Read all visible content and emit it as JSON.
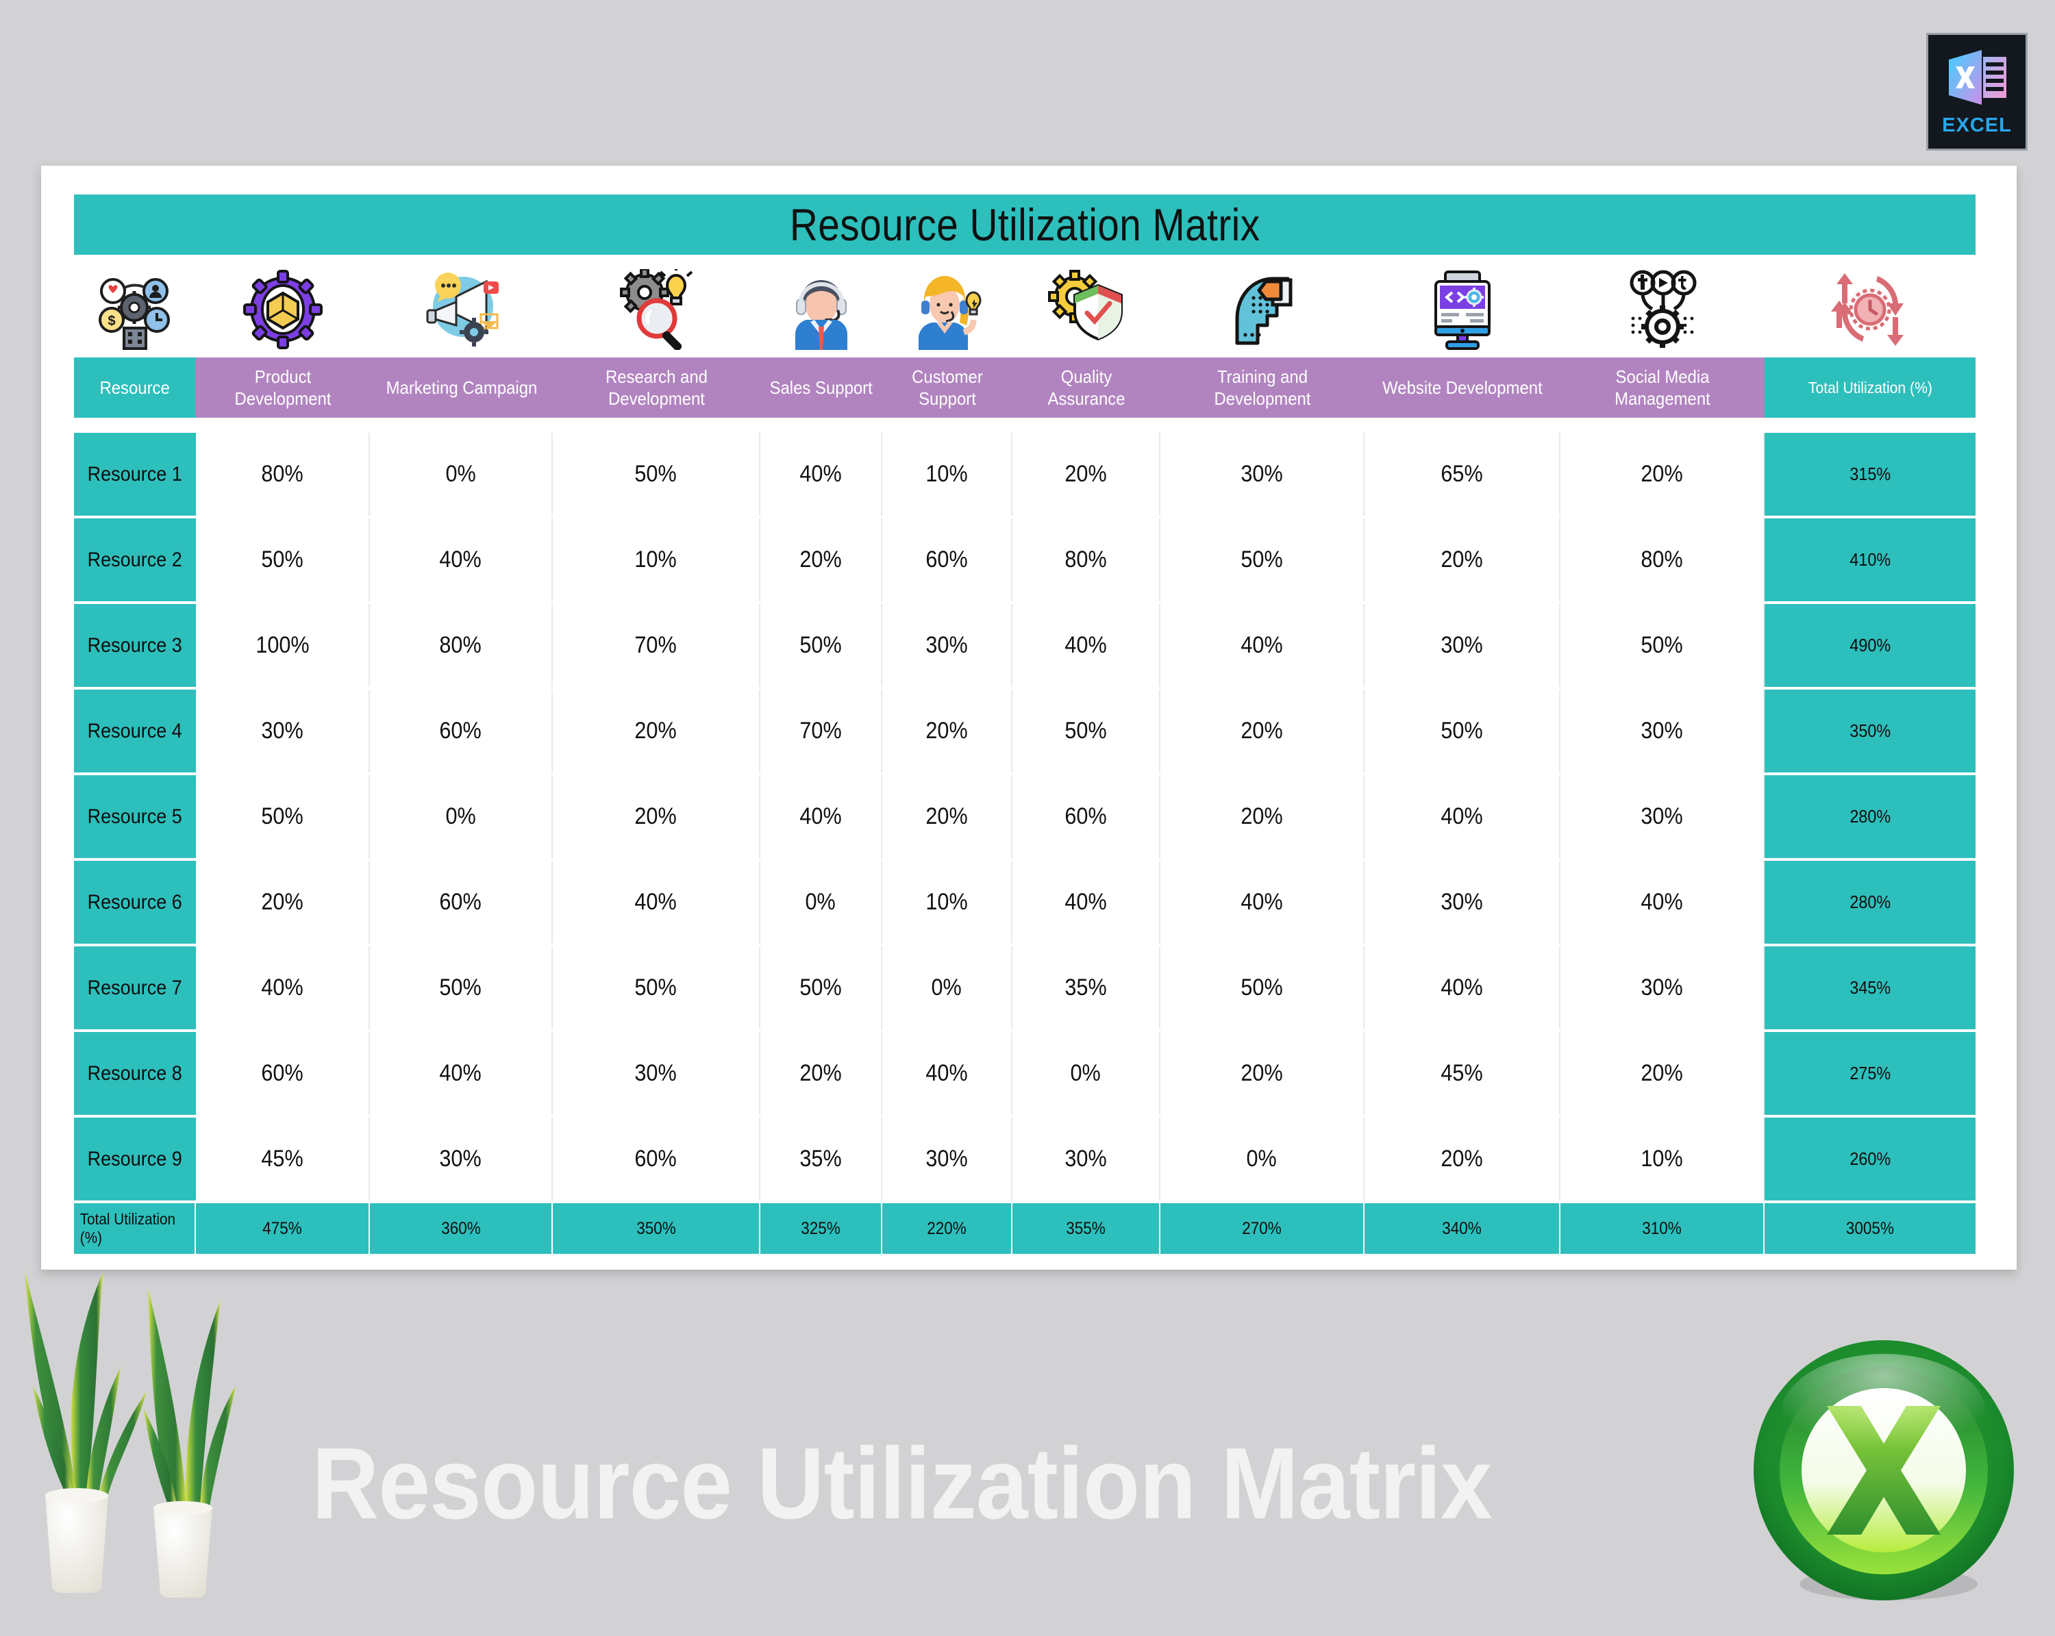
{
  "app_badge": {
    "label": "EXCEL",
    "icon": "excel-file-icon"
  },
  "sheet": {
    "title": "Resource Utilization Matrix",
    "header_icons": [
      "resource-management-icon",
      "product-development-gear-box-icon",
      "marketing-megaphone-icon",
      "research-gear-magnifier-bulb-icon",
      "sales-support-agent-icon",
      "customer-support-agent-icon",
      "quality-assurance-shield-gear-icon",
      "training-development-head-icon",
      "website-development-monitor-icon",
      "social-media-management-icon",
      "total-utilization-clock-arrows-icon"
    ],
    "columns": [
      "Resource",
      "Product Development",
      "Marketing Campaign",
      "Research and Development",
      "Sales Support",
      "Customer Support",
      "Quality Assurance",
      "Training and Development",
      "Website Development",
      "Social Media Management",
      "Total Utilization (%)"
    ],
    "total_row_label": "Total Utilization (%)"
  },
  "chart_data": {
    "type": "table",
    "title": "Resource Utilization Matrix",
    "categories": [
      "Product Development",
      "Marketing Campaign",
      "Research and Development",
      "Sales Support",
      "Customer Support",
      "Quality Assurance",
      "Training and Development",
      "Website Development",
      "Social Media Management"
    ],
    "row_labels": [
      "Resource 1",
      "Resource 2",
      "Resource 3",
      "Resource 4",
      "Resource 5",
      "Resource 6",
      "Resource 7",
      "Resource 8",
      "Resource 9"
    ],
    "rows": [
      {
        "label": "Resource 1",
        "values": [
          "80%",
          "0%",
          "50%",
          "40%",
          "10%",
          "20%",
          "30%",
          "65%",
          "20%"
        ],
        "total": "315%"
      },
      {
        "label": "Resource 2",
        "values": [
          "50%",
          "40%",
          "10%",
          "20%",
          "60%",
          "80%",
          "50%",
          "20%",
          "80%"
        ],
        "total": "410%"
      },
      {
        "label": "Resource 3",
        "values": [
          "100%",
          "80%",
          "70%",
          "50%",
          "30%",
          "40%",
          "40%",
          "30%",
          "50%"
        ],
        "total": "490%"
      },
      {
        "label": "Resource 4",
        "values": [
          "30%",
          "60%",
          "20%",
          "70%",
          "20%",
          "50%",
          "20%",
          "50%",
          "30%"
        ],
        "total": "350%"
      },
      {
        "label": "Resource 5",
        "values": [
          "50%",
          "0%",
          "20%",
          "40%",
          "20%",
          "60%",
          "20%",
          "40%",
          "30%"
        ],
        "total": "280%"
      },
      {
        "label": "Resource 6",
        "values": [
          "20%",
          "60%",
          "40%",
          "0%",
          "10%",
          "40%",
          "40%",
          "30%",
          "40%"
        ],
        "total": "280%"
      },
      {
        "label": "Resource 7",
        "values": [
          "40%",
          "50%",
          "50%",
          "50%",
          "0%",
          "35%",
          "50%",
          "40%",
          "30%"
        ],
        "total": "345%"
      },
      {
        "label": "Resource 8",
        "values": [
          "60%",
          "40%",
          "30%",
          "20%",
          "40%",
          "0%",
          "20%",
          "45%",
          "20%"
        ],
        "total": "275%"
      },
      {
        "label": "Resource 9",
        "values": [
          "45%",
          "30%",
          "60%",
          "35%",
          "30%",
          "30%",
          "0%",
          "20%",
          "10%"
        ],
        "total": "260%"
      }
    ],
    "column_totals": [
      "475%",
      "360%",
      "350%",
      "325%",
      "220%",
      "355%",
      "270%",
      "340%",
      "310%"
    ],
    "grand_total": "3005%",
    "ylabel": "",
    "xlabel": ""
  },
  "banner": {
    "text": "Resource Utilization Matrix",
    "logo": "excel-x-circle-logo",
    "decor": "snake-plants-photo"
  },
  "colors": {
    "teal": "#2dbfbc",
    "purple": "#b184c0",
    "page_background": "#d2d2d4",
    "sheet": "#ffffff",
    "cell_border": "#e9e9ea",
    "banner_text": "#f2f2f2"
  }
}
